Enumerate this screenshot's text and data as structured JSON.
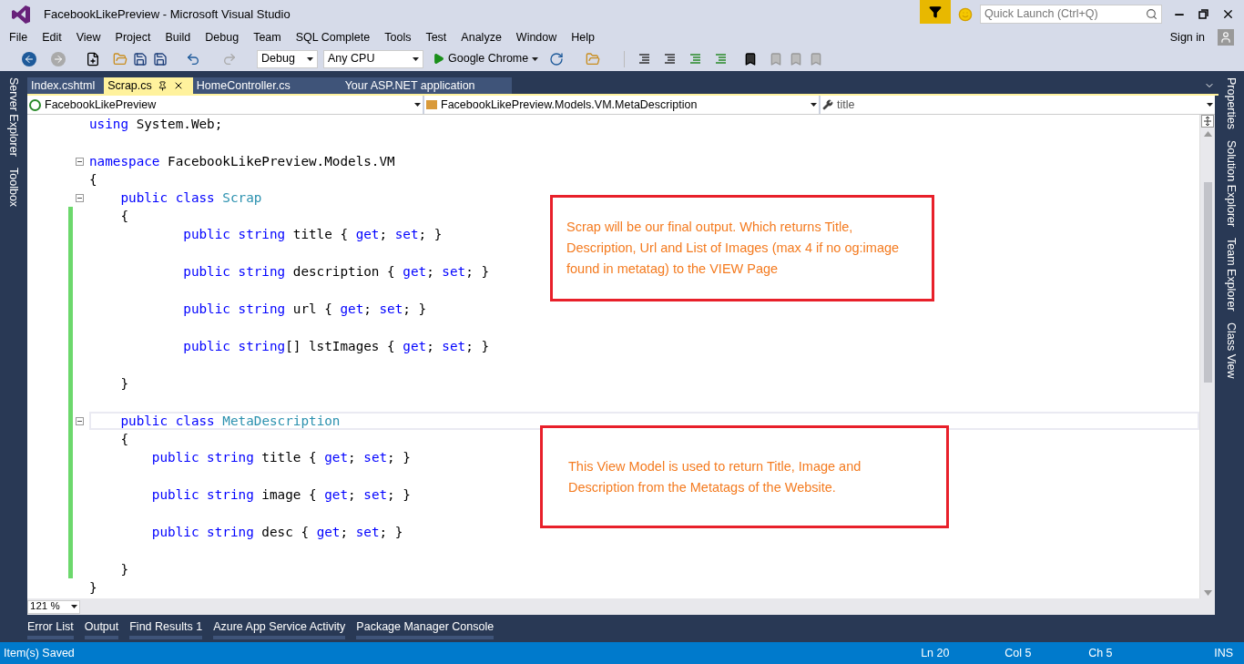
{
  "window": {
    "title": "FacebookLikePreview - Microsoft Visual Studio"
  },
  "quick_launch": {
    "placeholder": "Quick Launch (Ctrl+Q)"
  },
  "menu": [
    "File",
    "Edit",
    "View",
    "Project",
    "Build",
    "Debug",
    "Team",
    "SQL Complete",
    "Tools",
    "Test",
    "Analyze",
    "Window",
    "Help"
  ],
  "sign_in": "Sign in",
  "toolbar": {
    "configuration": "Debug",
    "platform": "Any CPU",
    "run_target": "Google Chrome"
  },
  "left_tool_tabs": [
    "Server Explorer",
    "Toolbox"
  ],
  "right_tool_tabs": [
    "Properties",
    "Solution Explorer",
    "Team Explorer",
    "Class View"
  ],
  "document_tabs": [
    {
      "label": "Index.cshtml",
      "selected": false
    },
    {
      "label": "Scrap.cs",
      "selected": true
    },
    {
      "label": "HomeController.cs",
      "selected": false
    },
    {
      "label": "Your ASP.NET application",
      "selected": false
    }
  ],
  "navigation_bar": {
    "project": "FacebookLikePreview",
    "type": "FacebookLikePreview.Models.VM.MetaDescription",
    "member": "title"
  },
  "code_lines": [
    {
      "segments": [
        {
          "kind": "keyword",
          "text": "using"
        },
        {
          "kind": "plain",
          "text": " System.Web;"
        }
      ],
      "changed": false,
      "fold": false,
      "current": false,
      "spaced": true
    },
    {
      "segments": [
        {
          "kind": "keyword",
          "text": "namespace"
        },
        {
          "kind": "plain",
          "text": " FacebookLikePreview.Models.VM"
        }
      ],
      "changed": false,
      "fold": true,
      "current": false,
      "spaced": false
    },
    {
      "segments": [
        {
          "kind": "plain",
          "text": "{"
        }
      ],
      "changed": false,
      "fold": false,
      "current": false,
      "spaced": false
    },
    {
      "segments": [
        {
          "kind": "keyword",
          "text": "    public class"
        },
        {
          "kind": "type",
          "text": " Scrap"
        }
      ],
      "changed": false,
      "fold": true,
      "current": false,
      "spaced": false
    },
    {
      "segments": [
        {
          "kind": "plain",
          "text": "    {"
        }
      ],
      "changed": true,
      "fold": false,
      "current": false,
      "spaced": false
    },
    {
      "segments": [
        {
          "kind": "keyword",
          "text": "            public string"
        },
        {
          "kind": "plain",
          "text": " title { "
        },
        {
          "kind": "keyword",
          "text": "get"
        },
        {
          "kind": "plain",
          "text": "; "
        },
        {
          "kind": "keyword",
          "text": "set"
        },
        {
          "kind": "plain",
          "text": "; }"
        }
      ],
      "changed": true,
      "fold": false,
      "current": false,
      "spaced": true
    },
    {
      "segments": [
        {
          "kind": "keyword",
          "text": "            public string"
        },
        {
          "kind": "plain",
          "text": " description { "
        },
        {
          "kind": "keyword",
          "text": "get"
        },
        {
          "kind": "plain",
          "text": "; "
        },
        {
          "kind": "keyword",
          "text": "set"
        },
        {
          "kind": "plain",
          "text": "; }"
        }
      ],
      "changed": true,
      "fold": false,
      "current": false,
      "spaced": true
    },
    {
      "segments": [
        {
          "kind": "keyword",
          "text": "            public string"
        },
        {
          "kind": "plain",
          "text": " url { "
        },
        {
          "kind": "keyword",
          "text": "get"
        },
        {
          "kind": "plain",
          "text": "; "
        },
        {
          "kind": "keyword",
          "text": "set"
        },
        {
          "kind": "plain",
          "text": "; }"
        }
      ],
      "changed": true,
      "fold": false,
      "current": false,
      "spaced": true
    },
    {
      "segments": [
        {
          "kind": "keyword",
          "text": "            public string"
        },
        {
          "kind": "plain",
          "text": "[] lstImages { "
        },
        {
          "kind": "keyword",
          "text": "get"
        },
        {
          "kind": "plain",
          "text": "; "
        },
        {
          "kind": "keyword",
          "text": "set"
        },
        {
          "kind": "plain",
          "text": "; }"
        }
      ],
      "changed": true,
      "fold": false,
      "current": false,
      "spaced": true
    },
    {
      "segments": [
        {
          "kind": "plain",
          "text": "    }"
        }
      ],
      "changed": true,
      "fold": false,
      "current": false,
      "spaced": true
    },
    {
      "segments": [
        {
          "kind": "keyword",
          "text": "    public class"
        },
        {
          "kind": "type",
          "text": " MetaDescription"
        }
      ],
      "changed": true,
      "fold": true,
      "current": true,
      "spaced": false
    },
    {
      "segments": [
        {
          "kind": "plain",
          "text": "    {"
        }
      ],
      "changed": true,
      "fold": false,
      "current": false,
      "spaced": false
    },
    {
      "segments": [
        {
          "kind": "keyword",
          "text": "        public string"
        },
        {
          "kind": "plain",
          "text": " title { "
        },
        {
          "kind": "keyword",
          "text": "get"
        },
        {
          "kind": "plain",
          "text": "; "
        },
        {
          "kind": "keyword",
          "text": "set"
        },
        {
          "kind": "plain",
          "text": "; }"
        }
      ],
      "changed": true,
      "fold": false,
      "current": false,
      "spaced": true
    },
    {
      "segments": [
        {
          "kind": "keyword",
          "text": "        public string"
        },
        {
          "kind": "plain",
          "text": " image { "
        },
        {
          "kind": "keyword",
          "text": "get"
        },
        {
          "kind": "plain",
          "text": "; "
        },
        {
          "kind": "keyword",
          "text": "set"
        },
        {
          "kind": "plain",
          "text": "; }"
        }
      ],
      "changed": true,
      "fold": false,
      "current": false,
      "spaced": true
    },
    {
      "segments": [
        {
          "kind": "keyword",
          "text": "        public string"
        },
        {
          "kind": "plain",
          "text": " desc { "
        },
        {
          "kind": "keyword",
          "text": "get"
        },
        {
          "kind": "plain",
          "text": "; "
        },
        {
          "kind": "keyword",
          "text": "set"
        },
        {
          "kind": "plain",
          "text": "; }"
        }
      ],
      "changed": true,
      "fold": false,
      "current": false,
      "spaced": true
    },
    {
      "segments": [
        {
          "kind": "plain",
          "text": "    }"
        }
      ],
      "changed": true,
      "fold": false,
      "current": false,
      "spaced": false
    },
    {
      "segments": [
        {
          "kind": "plain",
          "text": "}"
        }
      ],
      "changed": false,
      "fold": false,
      "current": false,
      "spaced": false
    }
  ],
  "annotations": [
    {
      "text": "Scrap will be our final output. Which returns Title, Description, Url and List of Images (max 4 if no og:image found in metatag) to the VIEW Page"
    },
    {
      "text": "This View Model is used to return Title, Image and Description from the Metatags of the Website."
    }
  ],
  "zoom": "121 %",
  "bottom_tabs": [
    "Error List",
    "Output",
    "Find Results 1",
    "Azure App Service Activity",
    "Package Manager Console"
  ],
  "status_bar": {
    "message": "Item(s) Saved",
    "line": "Ln 20",
    "column": "Col 5",
    "char": "Ch 5",
    "mode": "INS"
  }
}
